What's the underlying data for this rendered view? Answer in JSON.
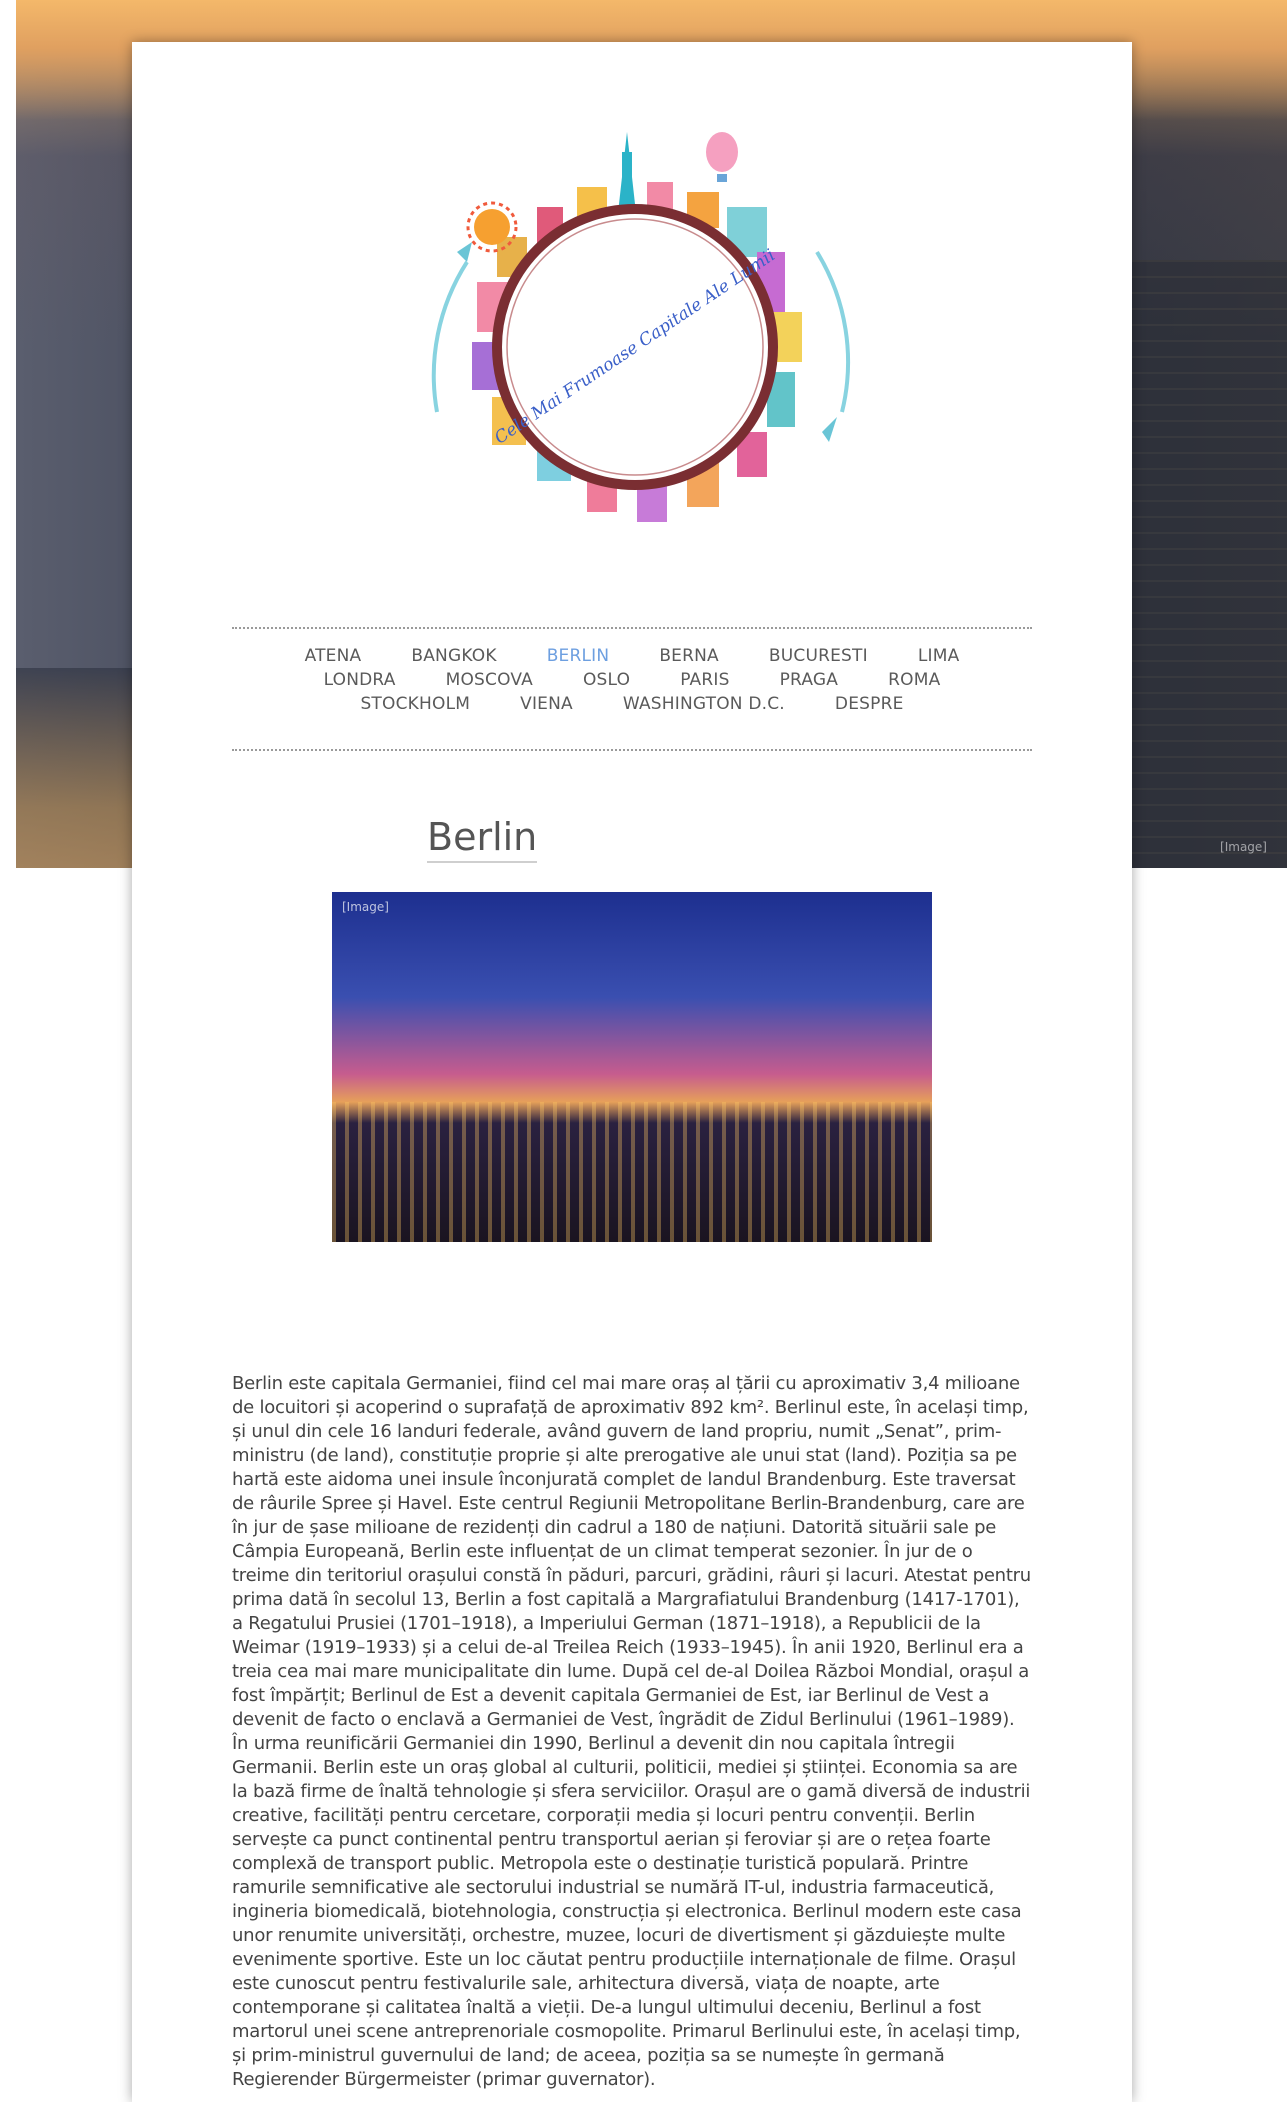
{
  "logo": {
    "tagline": "Cele Mai Frumoase Capitale Ale Lumii"
  },
  "nav": {
    "rows": [
      [
        "ATENA",
        "BANGKOK",
        "BERLIN",
        "BERNA",
        "BUCURESTI",
        "LIMA"
      ],
      [
        "LONDRA",
        "MOSCOVA",
        "OSLO",
        "PARIS",
        "PRAGA",
        "ROMA"
      ],
      [
        "STOCKHOLM",
        "VIENA",
        "WASHINGTON D.C.",
        "DESPRE"
      ]
    ],
    "active": "BERLIN"
  },
  "page": {
    "title": "Berlin",
    "body": "Berlin este capitala Germaniei, fiind cel mai mare oraș al țării cu aproximativ 3,4 milioane de locuitori și acoperind o suprafață de aproximativ 892 km². Berlinul este, în același timp, și unul din cele 16 landuri federale, având guvern de land propriu, numit „Senat”, prim-ministru (de land), constituție proprie și alte prerogative ale unui stat (land). Poziția sa pe hartă este aidoma unei insule înconjurată complet de landul Brandenburg. Este traversat de râurile Spree și Havel. Este centrul Regiunii Metropolitane Berlin-Brandenburg, care are în jur de șase milioane de rezidenți din cadrul a 180 de națiuni. Datorită situării sale pe Câmpia Europeană, Berlin este influențat de un climat temperat sezonier. În jur de o treime din teritoriul orașului constă în păduri, parcuri, grădini, râuri și lacuri. Atestat pentru prima dată în secolul 13, Berlin a fost capitală a Margrafiatului Brandenburg (1417-1701), a Regatului Prusiei (1701–1918), a Imperiului German (1871–1918), a Republicii de la Weimar (1919–1933) și a celui de-al Treilea Reich (1933–1945). În anii 1920, Berlinul era a treia cea mai mare municipalitate din lume. După cel de-al Doilea Război Mondial, orașul a fost împărțit; Berlinul de Est a devenit capitala Germaniei de Est, iar Berlinul de Vest a devenit de facto o enclavă a Germaniei de Vest, îngrădit de Zidul Berlinului (1961–1989). În urma reunificării Germaniei din 1990, Berlinul a devenit din nou capitala întregii Germanii. Berlin este un oraș global al culturii, politicii, mediei și științei. Economia sa are la bază firme de înaltă tehnologie și sfera serviciilor. Orașul are o gamă diversă de industrii creative, facilități pentru cercetare, corporații media și locuri pentru convenții. Berlin servește ca punct continental pentru transportul aerian și feroviar și are o rețea foarte complexă de transport public. Metropola este o destinație turistică populară. Printre ramurile semnificative ale sectorului industrial se numără IT-ul, industria farmaceutică, ingineria biomedicală, biotehnologia, construcția și electronica. Berlinul modern este casa unor renumite universități, orchestre, muzee, locuri de divertisment și găzduiește multe evenimente sportive. Este un loc căutat pentru producțiile internaționale de filme. Orașul este cunoscut pentru festivalurile sale, arhitectura diversă, viața de noapte, arte contemporane și calitatea înaltă a vieții. De-a lungul ultimului deceniu, Berlinul a fost martorul unei scene antreprenoriale cosmopolite. Primarul Berlinului este, în același timp, și prim-ministrul guvernului de land; de aceea, poziția sa se numește în germană Regierender Bürgermeister (primar guvernator)."
  },
  "colors": {
    "nav_active": "#6d9fe0",
    "nav_text": "#5a5a5a",
    "body_text": "#444444"
  }
}
